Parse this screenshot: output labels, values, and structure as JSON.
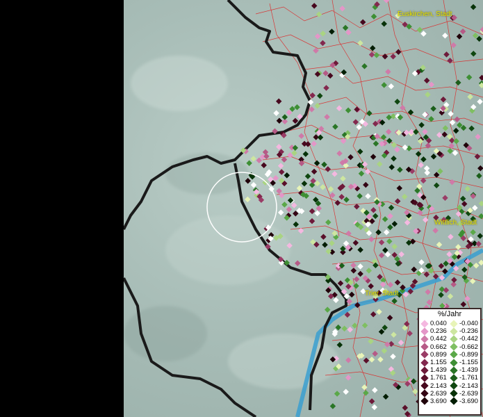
{
  "map": {
    "place_labels": [
      {
        "name": "Euskirchen, Stadt"
      },
      {
        "name": "Wittlich, Stadt"
      },
      {
        "name": "Trier, Stadt"
      }
    ],
    "colors": {
      "terrain": "#a8bdb7",
      "border": "#1a1a1a",
      "admin_lines": "#e02020",
      "river": "#3a9fd0",
      "circle": "#ffffff"
    }
  },
  "legend": {
    "title": "%/Jahr",
    "positive": [
      {
        "label": "0.040",
        "color": "#f4b8e0"
      },
      {
        "label": "0.236",
        "color": "#e496c8"
      },
      {
        "label": "0.442",
        "color": "#cf7aa8"
      },
      {
        "label": "0.662",
        "color": "#b65a86"
      },
      {
        "label": "0.899",
        "color": "#9a3c66"
      },
      {
        "label": "1.155",
        "color": "#83284e"
      },
      {
        "label": "1.439",
        "color": "#6e1a3a"
      },
      {
        "label": "1.761",
        "color": "#5a0f2a"
      },
      {
        "label": "2.143",
        "color": "#47081e"
      },
      {
        "label": "2.639",
        "color": "#340514"
      },
      {
        "label": "3.690",
        "color": "#20020a"
      }
    ],
    "negative": [
      {
        "label": "-0.040",
        "color": "#e8f4b8"
      },
      {
        "label": "-0.236",
        "color": "#cde6a0"
      },
      {
        "label": "-0.442",
        "color": "#a9d482"
      },
      {
        "label": "-0.662",
        "color": "#7fbf62"
      },
      {
        "label": "-0.899",
        "color": "#5aa848"
      },
      {
        "label": "-1.155",
        "color": "#3e8f34"
      },
      {
        "label": "-1.439",
        "color": "#2a7626"
      },
      {
        "label": "-1.761",
        "color": "#1b5e1a"
      },
      {
        "label": "-2.143",
        "color": "#0f4710"
      },
      {
        "label": "-2.639",
        "color": "#073208"
      },
      {
        "label": "-3.690",
        "color": "#021d03"
      }
    ]
  }
}
